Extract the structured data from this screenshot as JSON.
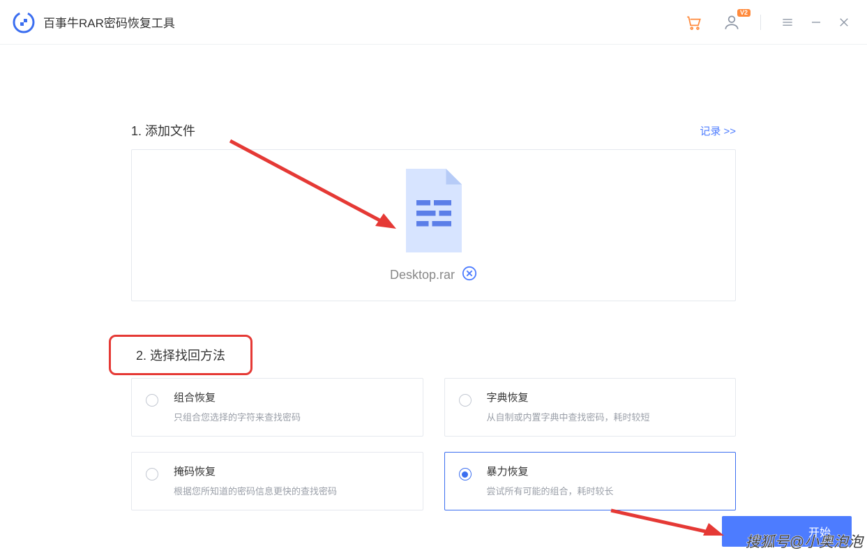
{
  "header": {
    "title": "百事牛RAR密码恢复工具",
    "vip_badge": "V2"
  },
  "step1": {
    "title": "1. 添加文件",
    "records_link": "记录 >>",
    "file_name": "Desktop.rar"
  },
  "step2": {
    "title": "2. 选择找回方法"
  },
  "methods": [
    {
      "title": "组合恢复",
      "desc": "只组合您选择的字符来查找密码",
      "selected": false
    },
    {
      "title": "字典恢复",
      "desc": "从自制或内置字典中查找密码，耗时较短",
      "selected": false
    },
    {
      "title": "掩码恢复",
      "desc": "根据您所知道的密码信息更快的查找密码",
      "selected": false
    },
    {
      "title": "暴力恢复",
      "desc": "尝试所有可能的组合，耗时较长",
      "selected": true
    }
  ],
  "actions": {
    "start": "开始"
  },
  "watermark": "搜狐号@小奥泡泡"
}
